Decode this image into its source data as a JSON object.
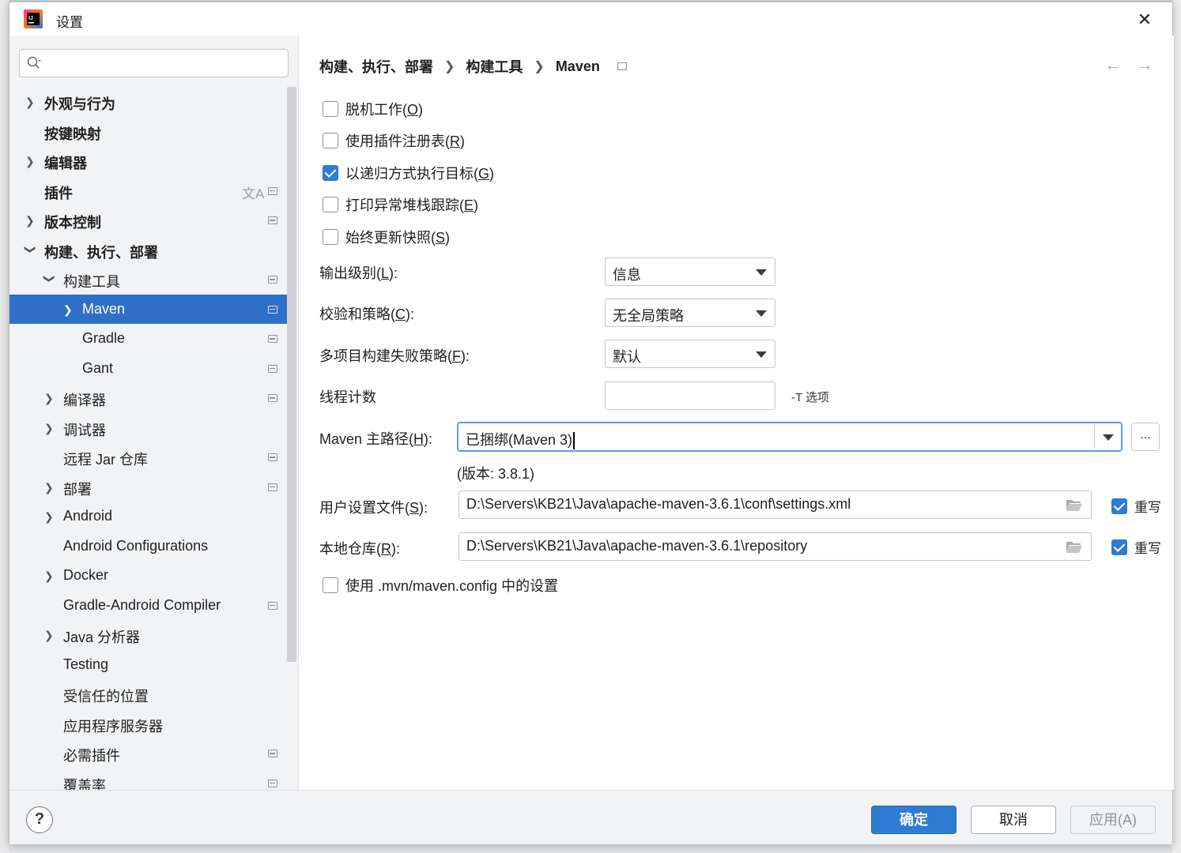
{
  "window": {
    "title": "设置"
  },
  "sidebar": {
    "search_placeholder": "",
    "items": [
      {
        "label": "外观与行为",
        "bold": true
      },
      {
        "label": "按键映射",
        "bold": true
      },
      {
        "label": "编辑器",
        "bold": true
      },
      {
        "label": "插件",
        "bold": true
      },
      {
        "label": "版本控制",
        "bold": true
      },
      {
        "label": "构建、执行、部署",
        "bold": true
      },
      {
        "label": "构建工具"
      },
      {
        "label": "Maven"
      },
      {
        "label": "Gradle"
      },
      {
        "label": "Gant"
      },
      {
        "label": "编译器"
      },
      {
        "label": "调试器"
      },
      {
        "label": "远程 Jar 仓库"
      },
      {
        "label": "部署"
      },
      {
        "label": "Android"
      },
      {
        "label": "Android Configurations"
      },
      {
        "label": "Docker"
      },
      {
        "label": "Gradle-Android Compiler"
      },
      {
        "label": "Java 分析器"
      },
      {
        "label": "Testing"
      },
      {
        "label": "受信任的位置"
      },
      {
        "label": "应用程序服务器"
      },
      {
        "label": "必需插件"
      },
      {
        "label": "覆盖率"
      }
    ]
  },
  "breadcrumb": [
    "构建、执行、部署",
    "构建工具",
    "Maven"
  ],
  "nav": {
    "back": "←",
    "forward": "→"
  },
  "options": {
    "offline": {
      "label": "脱机工作(",
      "key": "O",
      "end": ")",
      "checked": false
    },
    "plugin_registry": {
      "label": "使用插件注册表(",
      "key": "R",
      "end": ")",
      "checked": false
    },
    "recursive": {
      "label": "以递归方式执行目标(",
      "key": "G",
      "end": ")",
      "checked": true
    },
    "print_stack": {
      "label": "打印异常堆栈跟踪(",
      "key": "E",
      "end": ")",
      "checked": false
    },
    "always_update": {
      "label": "始终更新快照(",
      "key": "S",
      "end": ")",
      "checked": false
    }
  },
  "form": {
    "output_level": {
      "label_pre": "输出级别(",
      "key": "L",
      "label_post": "):",
      "value": "信息"
    },
    "checksum": {
      "label_pre": "校验和策略(",
      "key": "C",
      "label_post": "):",
      "value": "无全局策略"
    },
    "multiproject": {
      "label_pre": "多项目构建失败策略(",
      "key": "F",
      "label_post": "):",
      "value": "默认"
    },
    "threads": {
      "label": "线程计数",
      "value": "",
      "hint": "-T 选项"
    },
    "maven_home": {
      "label_pre": "Maven 主路径(",
      "key": "H",
      "label_post": "):",
      "value": "已捆绑(Maven 3)",
      "browse": "..."
    },
    "version": "(版本: 3.8.1)",
    "user_settings": {
      "label_pre": "用户设置文件(",
      "key": "S",
      "label_post": "):",
      "value": "D:\\Servers\\KB21\\Java\\apache-maven-3.6.1\\conf\\settings.xml",
      "override_label": "重写",
      "override_checked": true
    },
    "local_repo": {
      "label_pre": "本地仓库(",
      "key": "R",
      "label_post": "):",
      "value": "D:\\Servers\\KB21\\Java\\apache-maven-3.6.1\\repository",
      "override_label": "重写",
      "override_checked": true
    },
    "mvn_config": {
      "label": "使用 .mvn/maven.config 中的设置",
      "checked": false
    }
  },
  "footer": {
    "help": "?",
    "ok": "确定",
    "cancel": "取消",
    "apply": "应用(A)"
  },
  "colors": {
    "accent": "#2f7cd3",
    "selection": "#2f6fc8"
  }
}
